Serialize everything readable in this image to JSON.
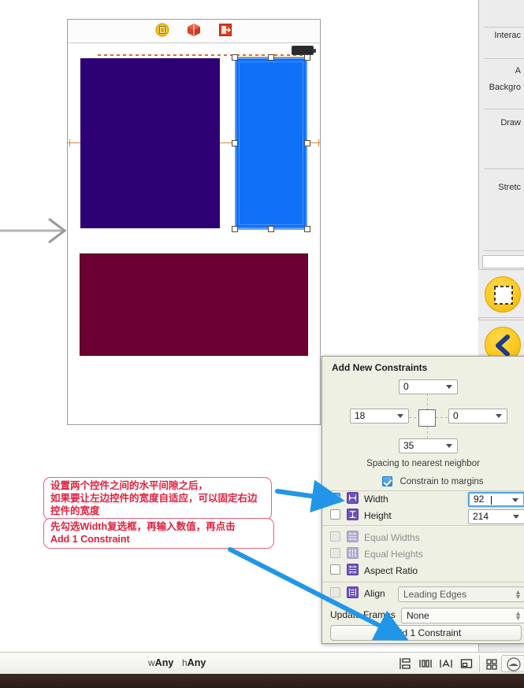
{
  "window": {
    "size_class": {
      "w_prefix": "w",
      "w_value": "Any",
      "h_prefix": "h",
      "h_value": "Any"
    }
  },
  "canvas": {
    "scene_icons": [
      {
        "name": "view-controller-icon",
        "title": "View Controller"
      },
      {
        "name": "first-responder-icon",
        "title": "First Responder"
      },
      {
        "name": "exit-segue-icon",
        "title": "Exit"
      }
    ],
    "views": [
      {
        "name": "purple-view",
        "color": "#2d0074",
        "selected": false
      },
      {
        "name": "blue-view",
        "color": "#1070f8",
        "selected": true
      },
      {
        "name": "maroon-view",
        "color": "#6d0033",
        "selected": false
      }
    ],
    "initial_vc_arrow": "→"
  },
  "inspector": {
    "labels": [
      "Interac",
      "A",
      "Backgro",
      "Draw",
      "Stretc"
    ],
    "buttons": [
      {
        "name": "constraints-round-button",
        "icon": "dashed-square-icon",
        "color": "#fdc91f"
      },
      {
        "name": "back-round-button",
        "icon": "chevron-left-icon",
        "color": "#fdc91f"
      }
    ]
  },
  "popover": {
    "title": "Add New Constraints",
    "spacing": {
      "top": "0",
      "leading": "18",
      "trailing": "0",
      "bottom": "35"
    },
    "note": "Spacing to nearest neighbor",
    "constrain_to_margins": {
      "label": "Constrain to margins",
      "checked": true
    },
    "rows": [
      {
        "name": "width",
        "label": "Width",
        "checked": true,
        "enabled": true,
        "value": "92",
        "focused": true
      },
      {
        "name": "height",
        "label": "Height",
        "checked": false,
        "enabled": true,
        "value": "214",
        "focused": false
      },
      {
        "name": "equal-widths",
        "label": "Equal Widths",
        "checked": false,
        "enabled": false
      },
      {
        "name": "equal-heights",
        "label": "Equal Heights",
        "checked": false,
        "enabled": false
      },
      {
        "name": "aspect-ratio",
        "label": "Aspect Ratio",
        "checked": false,
        "enabled": true
      }
    ],
    "align": {
      "label": "Align",
      "checked": false,
      "value": "Leading Edges"
    },
    "update_frames": {
      "label": "Update Frames",
      "value": "None"
    },
    "add_button": "Add 1 Constraint"
  },
  "annotations": {
    "note1": "设置两个控件之间的水平间隙之后，\n如果要让左边控件的宽度自适应，可以固定右边\n控件的宽度",
    "note2": "先勾选Width复选框，再输入数值，再点击\nAdd 1 Constraint",
    "arrow_color": "#2196e8"
  },
  "bottom_toolbar": {
    "items": [
      {
        "name": "stack-button",
        "icon": "stack-icon"
      },
      {
        "name": "align-button",
        "icon": "align-icon"
      },
      {
        "name": "pin-button",
        "icon": "pin-icon"
      },
      {
        "name": "resolve-issues-button",
        "icon": "resolve-icon"
      },
      {
        "name": "grid-view-button",
        "icon": "grid-icon"
      },
      {
        "name": "assistant-button",
        "icon": "assistant-icon"
      }
    ]
  }
}
